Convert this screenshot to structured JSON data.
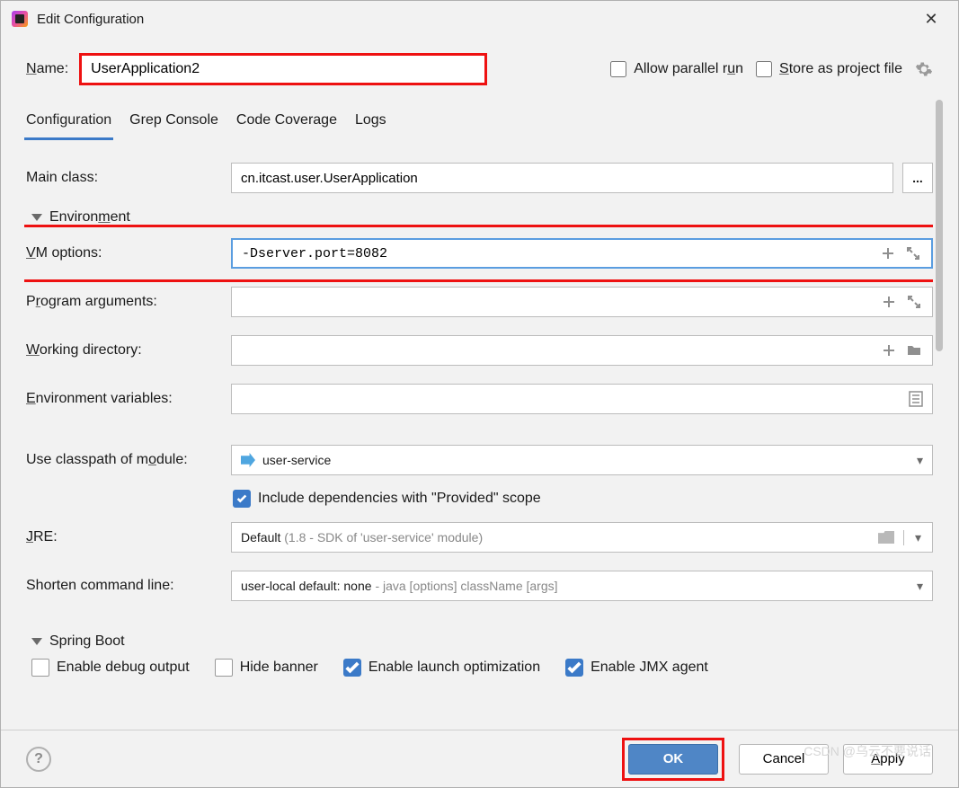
{
  "window": {
    "title": "Edit Configuration"
  },
  "name": {
    "label": "Name:",
    "value": "UserApplication2"
  },
  "allowParallel": {
    "label": "Allow parallel run",
    "checked": false
  },
  "storeAsFile": {
    "label": "Store as project file",
    "checked": false
  },
  "tabs": [
    "Configuration",
    "Grep Console",
    "Code Coverage",
    "Logs"
  ],
  "activeTab": 0,
  "mainClass": {
    "label": "Main class:",
    "value": "cn.itcast.user.UserApplication"
  },
  "envHeader": "Environment",
  "vmOptions": {
    "label": "VM options:",
    "value": "-Dserver.port=8082"
  },
  "programArgs": {
    "label": "Program arguments:",
    "value": ""
  },
  "workingDir": {
    "label": "Working directory:",
    "value": ""
  },
  "envVars": {
    "label": "Environment variables:",
    "value": ""
  },
  "classpath": {
    "label": "Use classpath of module:",
    "value": "user-service"
  },
  "includeProvided": {
    "label": "Include dependencies with \"Provided\" scope",
    "checked": true
  },
  "jre": {
    "label": "JRE:",
    "prefix": "Default ",
    "hint": "(1.8 - SDK of 'user-service' module)"
  },
  "shorten": {
    "label": "Shorten command line:",
    "prefix": "user-local default: none ",
    "hint": "- java [options] className [args]"
  },
  "springHeader": "Spring Boot",
  "springOpts": {
    "debug": {
      "label": "Enable debug output",
      "checked": false
    },
    "hideBanner": {
      "label": "Hide banner",
      "checked": false
    },
    "launchOpt": {
      "label": "Enable launch optimization",
      "checked": true
    },
    "jmx": {
      "label": "Enable JMX agent",
      "checked": true
    }
  },
  "buttons": {
    "ok": "OK",
    "cancel": "Cancel",
    "apply": "Apply"
  },
  "watermark": "CSDN @乌云不要说话"
}
